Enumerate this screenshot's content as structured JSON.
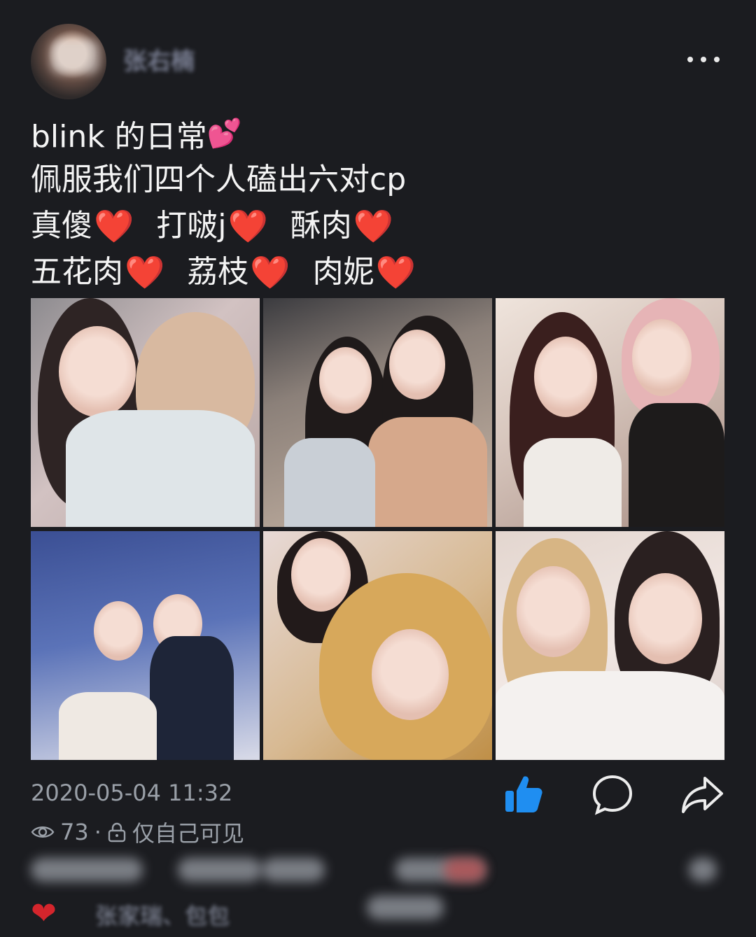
{
  "header": {
    "username": "张右楠",
    "more_icon": "more-horizontal-icon"
  },
  "post": {
    "lines": [
      {
        "text": "blink 的日常",
        "emoji": "💕"
      },
      {
        "segments": [
          "佩服我们四个人磕出六对cp"
        ]
      },
      {
        "segments": [
          "真傻",
          "打啵j",
          "酥肉"
        ]
      },
      {
        "segments": [
          "五花肉",
          "荔枝",
          "肉妮"
        ]
      }
    ],
    "heart_emoji": "❤️",
    "images": [
      {
        "alt": "photo 1"
      },
      {
        "alt": "photo 2"
      },
      {
        "alt": "photo 3"
      },
      {
        "alt": "photo 4"
      },
      {
        "alt": "photo 5"
      },
      {
        "alt": "photo 6"
      }
    ]
  },
  "meta": {
    "timestamp": "2020-05-04 11:32",
    "views": "73",
    "separator": "·",
    "visibility": "仅自己可见"
  },
  "actions": {
    "like_icon": "thumbs-up-icon",
    "comment_icon": "comment-icon",
    "share_icon": "share-icon"
  },
  "likes": {
    "heart_icon": "heart-icon",
    "names": "张家瑞、包包"
  },
  "colors": {
    "background": "#1b1c20",
    "like_blue": "#1f8ef1",
    "meta_gray": "#9aa0a8",
    "heart_red": "#e3262d"
  }
}
